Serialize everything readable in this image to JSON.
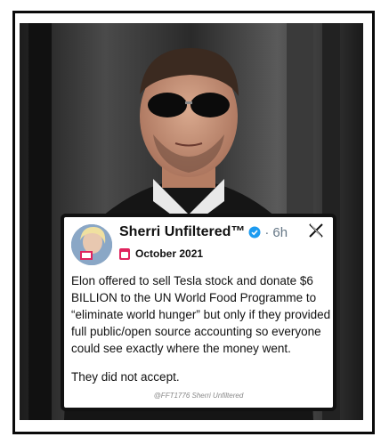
{
  "tweet": {
    "author_name": "Sherri Unfiltered™",
    "time_separator": "·",
    "time_ago": "6h",
    "date": "October 2021",
    "body_paragraph_1": "Elon offered to sell Tesla stock and donate $6 BILLION to the UN World Food Programme to “eliminate world hunger” but only if they provided full public/open source accounting so everyone could see exactly where the money went.",
    "body_paragraph_2": "They did not accept.",
    "watermark": "@FFT1776 Sherri Unfiltered"
  },
  "icons": {
    "verified": "verified-badge-icon",
    "close": "x-logo-icon",
    "calendar": "calendar-icon"
  },
  "colors": {
    "verified": "#1d9bf0",
    "meta_gray": "#657786",
    "calendar_red": "#e0245e"
  }
}
